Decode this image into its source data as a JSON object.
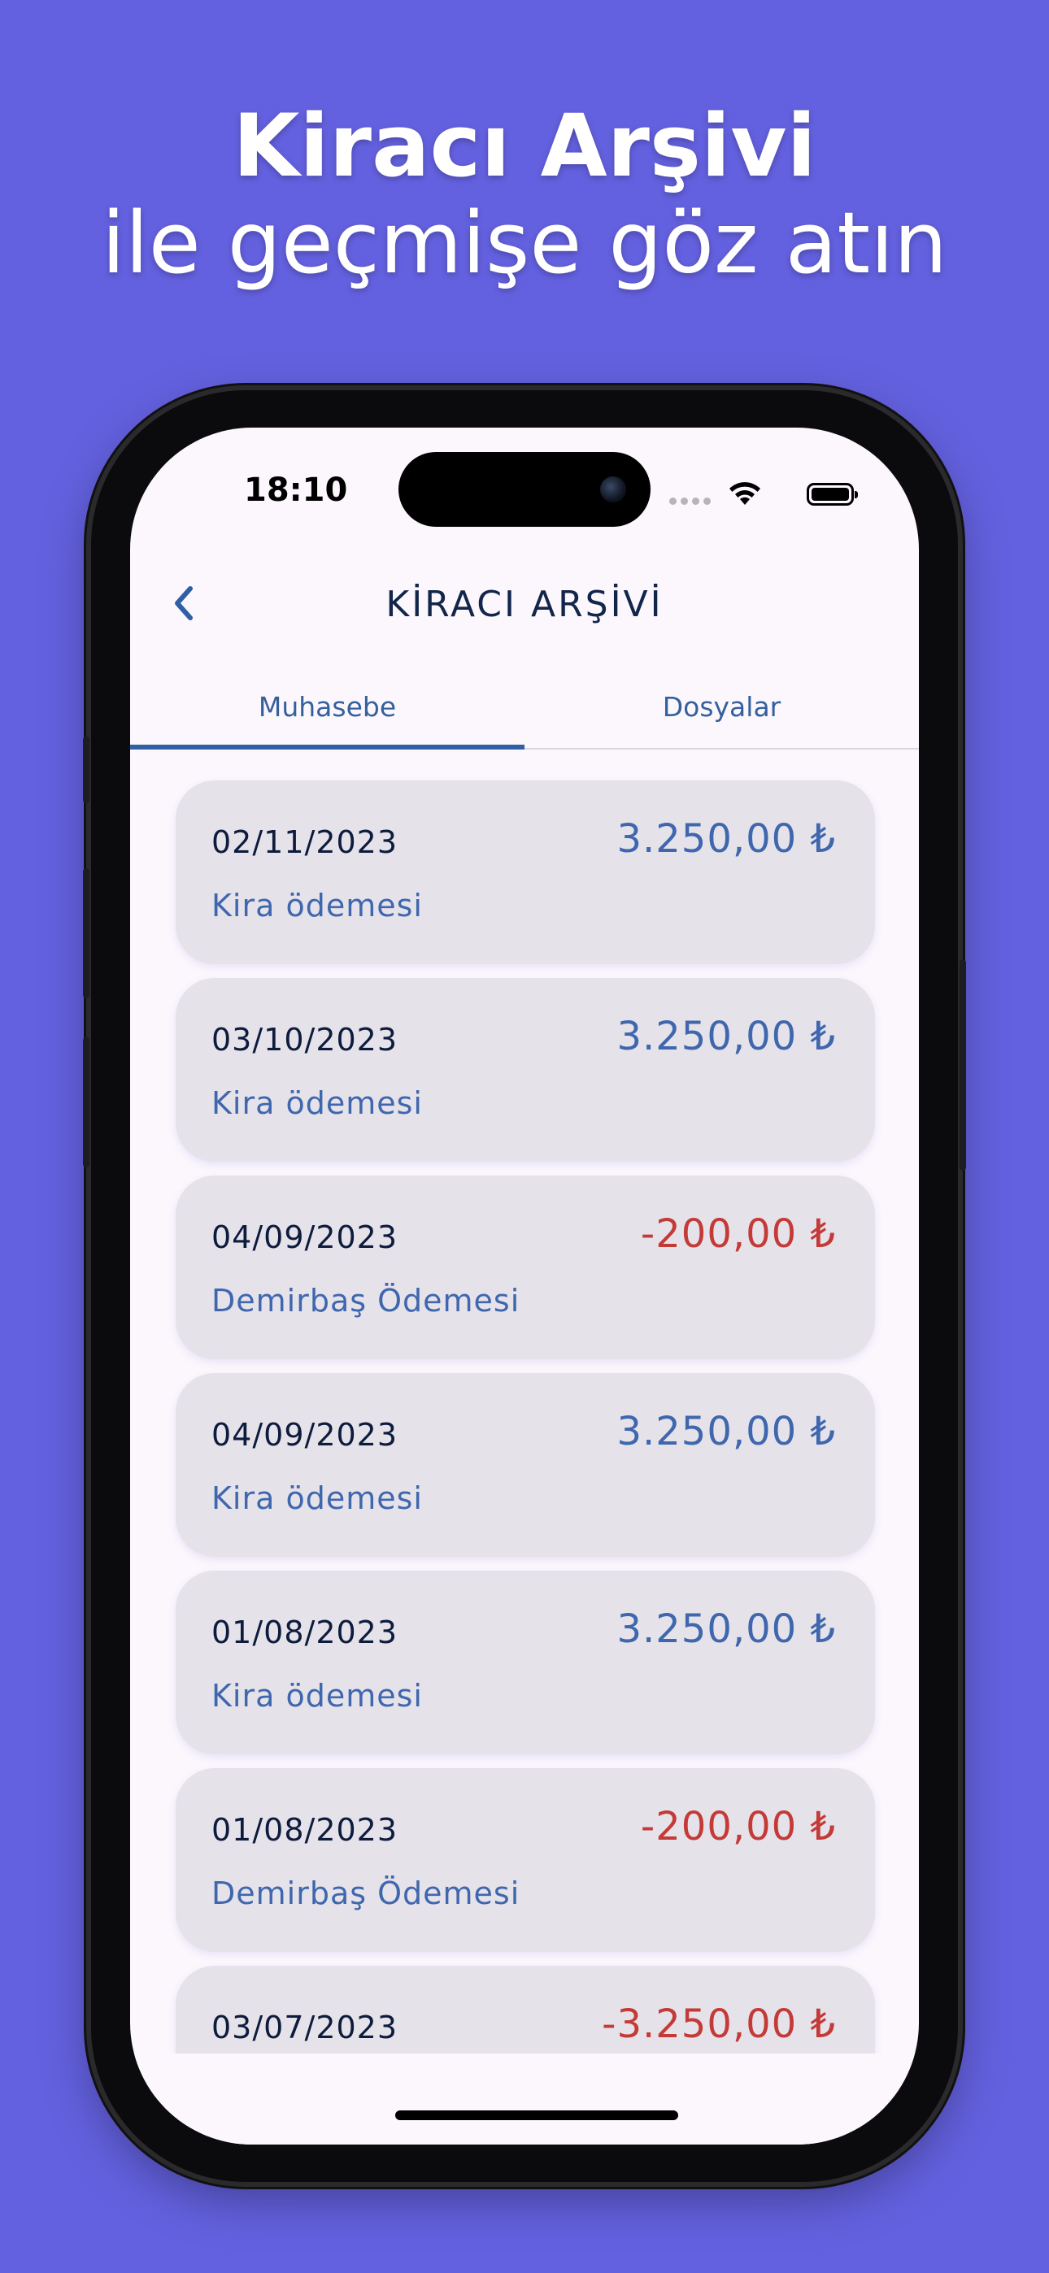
{
  "headline": {
    "line1": "Kiracı Arşivi",
    "line2": "ile geçmişe göz atın"
  },
  "status_bar": {
    "time": "18:10"
  },
  "nav": {
    "title": "KİRACI ARŞİVİ",
    "back_icon": "chevron-left-icon"
  },
  "tabs": [
    {
      "label": "Muhasebe",
      "active": true
    },
    {
      "label": "Dosyalar",
      "active": false
    }
  ],
  "colors": {
    "background": "#6461E0",
    "positive_amount": "#3F67AE",
    "negative_amount": "#C43A37",
    "card_background": "#E6E2EA"
  },
  "transactions": [
    {
      "date": "02/11/2023",
      "description": "Kira ödemesi",
      "amount": "3.250,00 ₺",
      "negative": false
    },
    {
      "date": "03/10/2023",
      "description": "Kira ödemesi",
      "amount": "3.250,00 ₺",
      "negative": false
    },
    {
      "date": "04/09/2023",
      "description": "Demirbaş Ödemesi",
      "amount": "-200,00 ₺",
      "negative": true
    },
    {
      "date": "04/09/2023",
      "description": "Kira ödemesi",
      "amount": "3.250,00 ₺",
      "negative": false
    },
    {
      "date": "01/08/2023",
      "description": "Kira ödemesi",
      "amount": "3.250,00 ₺",
      "negative": false
    },
    {
      "date": "01/08/2023",
      "description": "Demirbaş Ödemesi",
      "amount": "-200,00 ₺",
      "negative": true
    },
    {
      "date": "03/07/2023",
      "description": "",
      "amount": "-3.250,00 ₺",
      "negative": true
    }
  ]
}
